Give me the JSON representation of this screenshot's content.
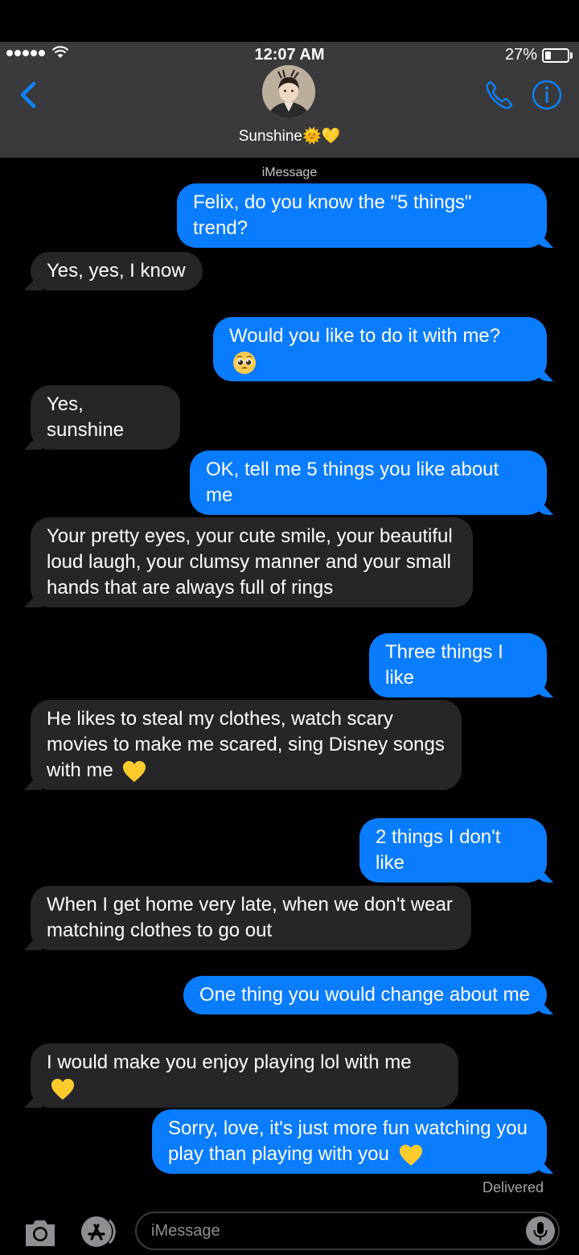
{
  "status_bar": {
    "time": "12:07 AM",
    "battery": "27%"
  },
  "header": {
    "contact_name": "Sunshine🌞💛"
  },
  "thread": {
    "service_label": "iMessage",
    "messages": [
      {
        "from": "me",
        "text": "Felix, do you know the \"5 things\" trend?"
      },
      {
        "from": "them",
        "text": "Yes, yes, I know"
      },
      {
        "from": "me",
        "text": "Would you like to do it with me?",
        "emoji": "pleading-face"
      },
      {
        "from": "them",
        "text": "Yes, sunshine"
      },
      {
        "from": "me",
        "text": "OK, tell me 5 things you like about me"
      },
      {
        "from": "them",
        "text": "Your pretty eyes, your cute smile, your beautiful loud laugh, your clumsy manner and your small hands that are always full of rings"
      },
      {
        "from": "me",
        "text": "Three things I like"
      },
      {
        "from": "them",
        "text": "He likes to steal my clothes, watch scary movies to make me scared, sing Disney songs with me",
        "emoji": "yellow-heart"
      },
      {
        "from": "me",
        "text": "2 things I don't like"
      },
      {
        "from": "them",
        "text": "When I get home very late, when we don't wear matching clothes to go out"
      },
      {
        "from": "me",
        "text": "One thing you would change about me"
      },
      {
        "from": "them",
        "text": "I would make you enjoy playing lol with me",
        "emoji": "yellow-heart"
      },
      {
        "from": "me",
        "text": "Sorry, love, it's just more fun watching you play than playing with you",
        "emoji": "yellow-heart"
      }
    ],
    "delivered_label": "Delivered"
  },
  "input_bar": {
    "placeholder": "iMessage"
  },
  "colors": {
    "sent_bubble": "#0a7cff",
    "received_bubble": "#262628",
    "accent": "#0a84ff"
  }
}
